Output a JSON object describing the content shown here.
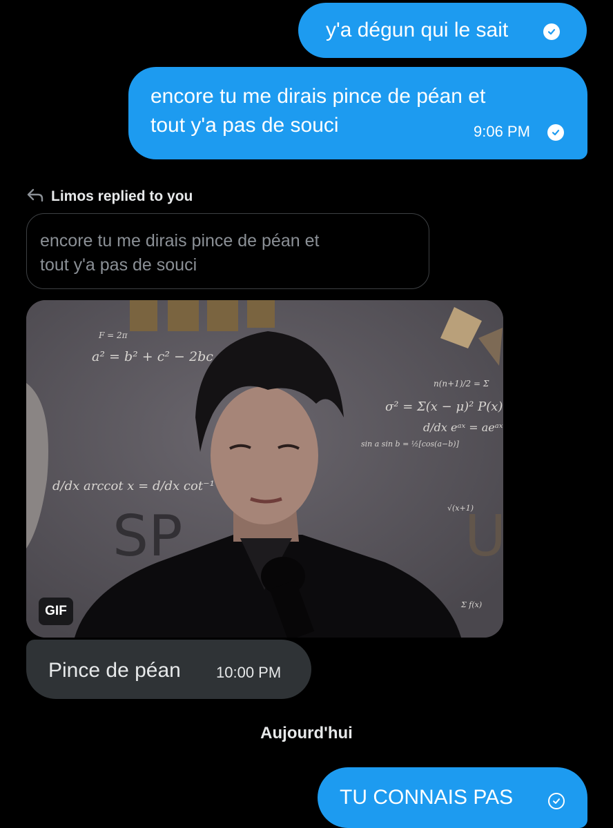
{
  "conversation": {
    "messages": [
      {
        "text": "y'a dégun qui le sait",
        "status_icon": "check-circle-filled-icon"
      },
      {
        "text_lines": [
          "encore tu me dirais pince de péan et",
          "tout y'a pas de souci"
        ],
        "time": "9:06 PM",
        "status_icon": "check-circle-filled-icon"
      }
    ],
    "reply": {
      "header_icon": "reply-arrow-icon",
      "header_label": "Limos replied to you",
      "quoted_lines": [
        "encore tu me dirais pince de péan et",
        "tout y'a pas de souci"
      ],
      "media_badge": "GIF",
      "text": "Pince de péan",
      "time": "10:00 PM"
    },
    "day_divider": "Aujourd'hui",
    "last_message": {
      "text": "TU CONNAIS PAS",
      "status_icon": "check-circle-outline-icon"
    }
  },
  "colors": {
    "background": "#000000",
    "outgoing_bubble": "#1d9bf0",
    "incoming_bubble": "#2f3336",
    "quoted_text": "#8b9096"
  }
}
